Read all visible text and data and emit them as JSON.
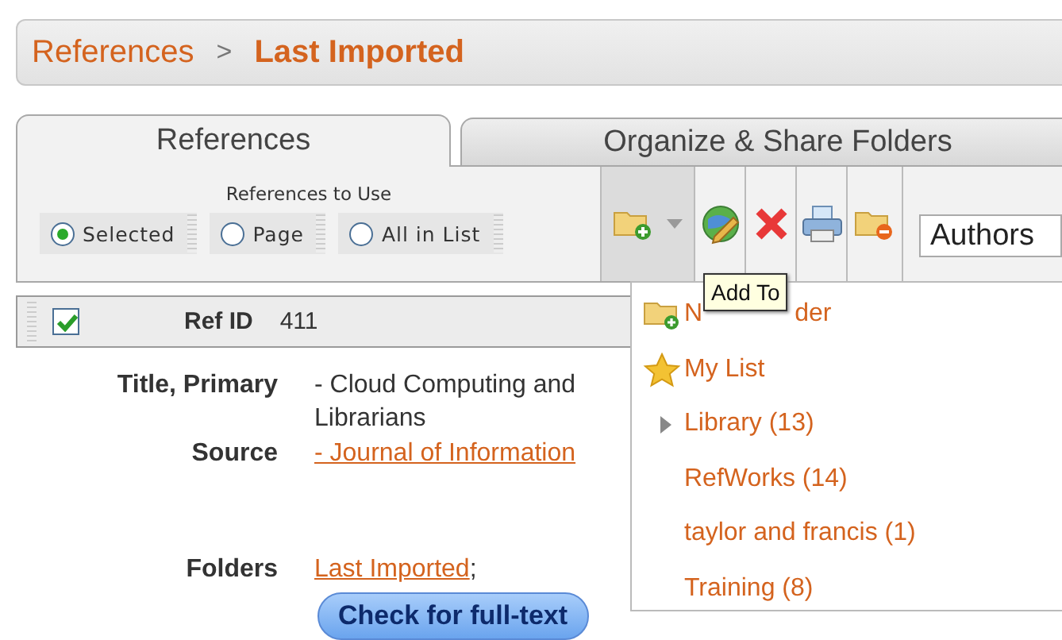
{
  "breadcrumb": {
    "root": "References",
    "separator": ">",
    "current": "Last Imported"
  },
  "tabs": [
    {
      "label": "References",
      "selected": true
    },
    {
      "label": "Organize & Share Folders",
      "selected": false
    }
  ],
  "references_to_use": {
    "label": "References to Use",
    "options": [
      {
        "label": "Selected",
        "selected": true
      },
      {
        "label": "Page",
        "selected": false
      },
      {
        "label": "All in List",
        "selected": false
      }
    ]
  },
  "sort_field": "Authors",
  "tooltip": "Add To",
  "record": {
    "checked": true,
    "ref_id_label": "Ref ID",
    "ref_id": "411",
    "fields": [
      {
        "label": "Title, Primary",
        "kind": "text",
        "lines": [
          "- Cloud Computing and",
          "Librarians"
        ]
      },
      {
        "label": "Source",
        "kind": "link",
        "lines": [
          "- Journal of Information"
        ]
      },
      {
        "label": "Folders",
        "kind": "folders",
        "lines": [
          "Last Imported",
          ";"
        ]
      }
    ]
  },
  "full_text_button": "Check for full-text",
  "menu": {
    "items": [
      {
        "parts": [
          "N",
          "der"
        ],
        "kind": "new"
      },
      {
        "label": "My List",
        "kind": "star"
      },
      {
        "label": "Library (13)",
        "kind": "expandable"
      },
      {
        "label": "RefWorks (14)",
        "kind": "folder"
      },
      {
        "label": "taylor and francis (1)",
        "kind": "folder"
      },
      {
        "label": "Training (8)",
        "kind": "folder"
      }
    ]
  }
}
